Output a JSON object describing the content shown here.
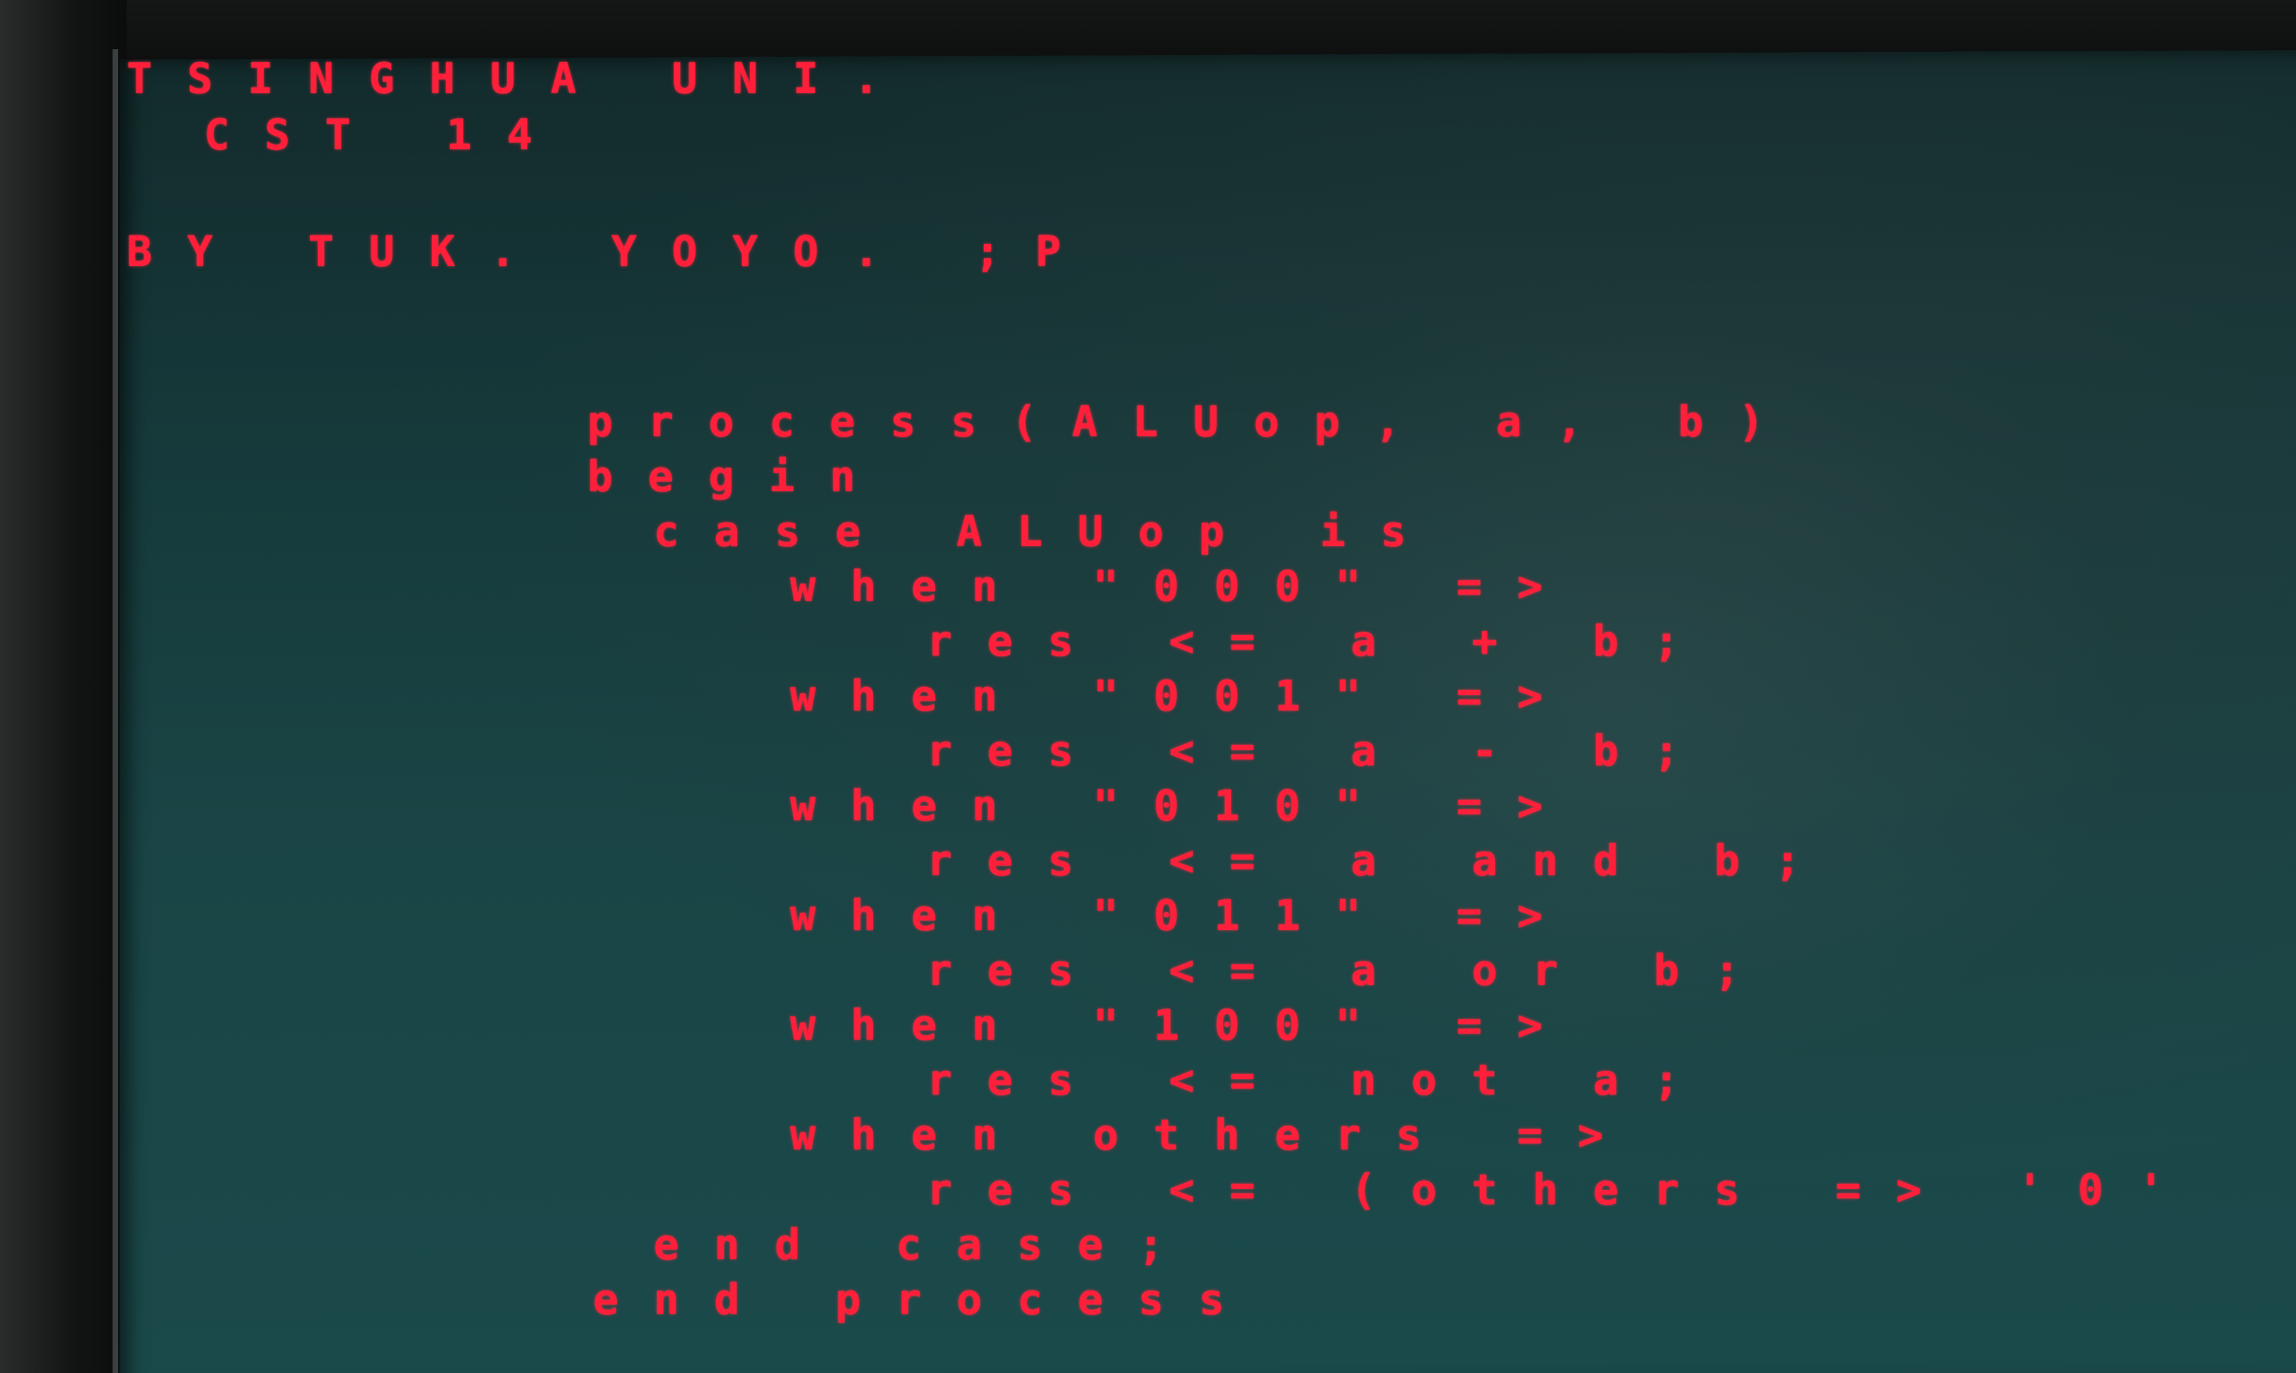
{
  "header": {
    "line1": "TSINGHUA UNI.",
    "line2": "CST 14",
    "line3": "BY TUK. YOYO. ;P"
  },
  "code": [
    "process(ALUop, a, b)",
    "begin",
    " case ALUop is",
    "  when \"000\" =>",
    "   res <= a + b;",
    "  when \"001\" =>",
    "   res <= a - b;",
    "  when \"010\" =>",
    "   res <= a and b;",
    "  when \"011\" =>",
    "   res <= a or b;",
    "  when \"100\" =>",
    "   res <= not a;",
    "  when others =>",
    "   res <= (others => '0'",
    " end case;",
    "end process"
  ],
  "colors": {
    "text": "#ff1f3a",
    "screen": "#174041"
  }
}
